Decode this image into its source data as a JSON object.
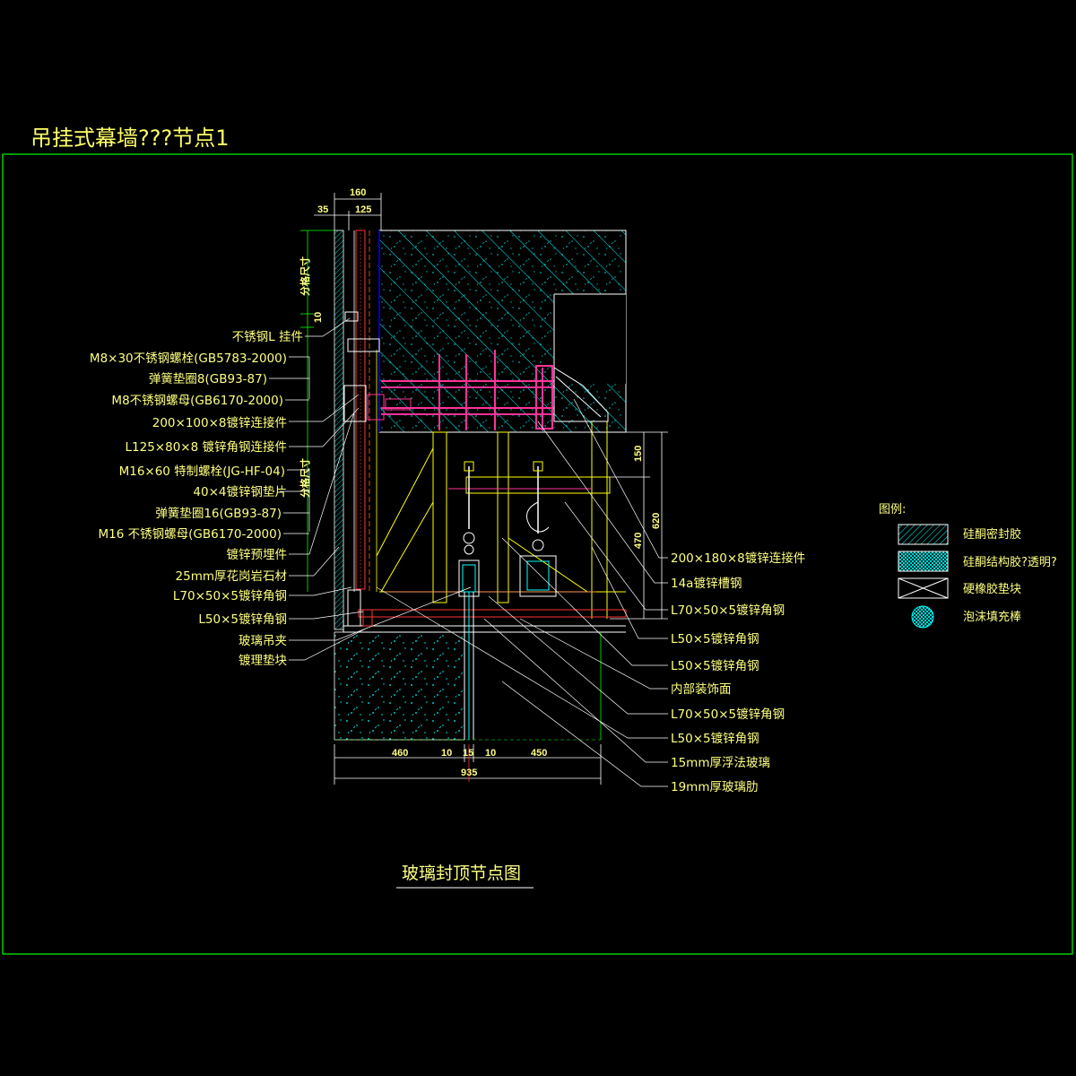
{
  "sheet_title": "吊挂式幕墙???节点1",
  "caption": "玻璃封顶节点图",
  "left_callouts": [
    "不锈钢L 挂件",
    "M8×30不锈钢螺栓(GB5783-2000)",
    "弹簧垫圈8(GB93-87)",
    "M8不锈钢螺母(GB6170-2000)",
    "200×100×8镀锌连接件",
    "L125×80×8 镀锌角钢连接件",
    "M16×60 特制螺栓(JG-HF-04)",
    "40×4镀锌钢垫片",
    "弹簧垫圈16(GB93-87)",
    "M16 不锈钢螺母(GB6170-2000)",
    "镀锌预埋件",
    "25mm厚花岗岩石材",
    "L70×50×5镀锌角钢",
    "L50×5镀锌角钢",
    "玻璃吊夹",
    "镀理垫块"
  ],
  "right_callouts": [
    "200×180×8镀锌连接件",
    "14a镀锌槽钢",
    "L70×50×5镀锌角钢",
    "L50×5镀锌角钢",
    "L50×5镀锌角钢",
    "内部装饰面",
    "L70×50×5镀锌角钢",
    "L50×5镀锌角钢",
    "15mm厚浮法玻璃",
    "19mm厚玻璃肋"
  ],
  "vertical_notes": {
    "upper": "分格尺寸",
    "lower": "分格尺寸"
  },
  "dimensions": {
    "top_total": "160",
    "top_left": "35",
    "top_right": "125",
    "vertical_small": "10",
    "right_upper": "150",
    "right_total": "620",
    "right_lower": "470",
    "bottom_segments": [
      "460",
      "10",
      "15",
      "10",
      "450"
    ],
    "bottom_total": "935"
  },
  "legend": {
    "title": "图例:",
    "items": [
      {
        "icon": "hatch-diagonal-icon",
        "label": "硅酮密封胶"
      },
      {
        "icon": "hatch-crosshatch-icon",
        "label": "硅酮结构胶?透明?"
      },
      {
        "icon": "x-box-icon",
        "label": "硬橡胶垫块"
      },
      {
        "icon": "foam-rod-icon",
        "label": "泡沫填充棒"
      }
    ]
  },
  "colors": {
    "background": "#000000",
    "frame": "#00ff00",
    "text": "#ffff80",
    "concrete": "#00ffff",
    "steel": "#ff3399",
    "outline": "#ffffff",
    "granite": "#ff3333"
  }
}
